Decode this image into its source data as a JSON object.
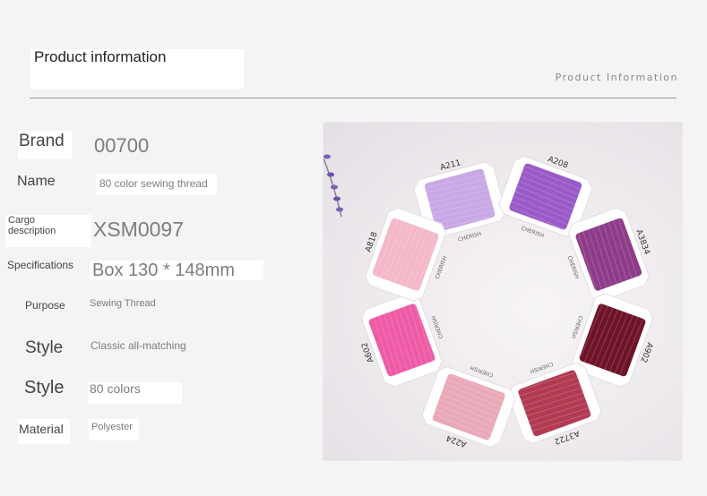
{
  "header": {
    "title": "Product information",
    "subtitle": "Product Information"
  },
  "specs": [
    {
      "label": "Brand",
      "value": "00700"
    },
    {
      "label": "Name",
      "value": "80 color sewing thread"
    },
    {
      "label_line1": "Cargo",
      "label_line2": "description",
      "value": "XSM0097"
    },
    {
      "label": "Specifications",
      "value": "Box 130 * 148mm"
    },
    {
      "label": "Purpose",
      "value": "Sewing Thread"
    },
    {
      "label": "Style",
      "value": "Classic all-matching"
    },
    {
      "label": "Style",
      "value": "80 colors"
    },
    {
      "label": "Material",
      "value": "Polyester"
    }
  ],
  "photo": {
    "card_brand": "CHERISH",
    "bobbins": [
      {
        "code": "A211",
        "color": "#c9a8e6"
      },
      {
        "code": "A208",
        "color": "#9a5bc8"
      },
      {
        "code": "A3834",
        "color": "#8e3c8a"
      },
      {
        "code": "A902",
        "color": "#6e1428"
      },
      {
        "code": "A3722",
        "color": "#b23a52"
      },
      {
        "code": "A224",
        "color": "#eaa9b8"
      },
      {
        "code": "A602",
        "color": "#ef5aa6"
      },
      {
        "code": "A818",
        "color": "#f4b8c9"
      }
    ]
  }
}
